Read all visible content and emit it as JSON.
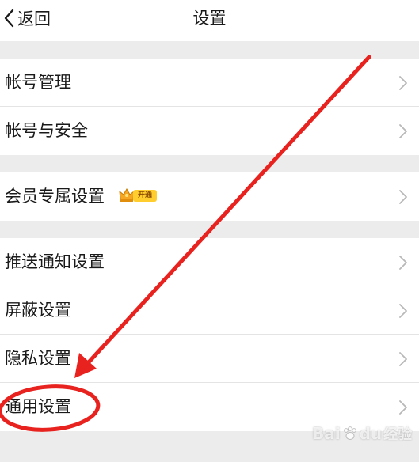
{
  "navbar": {
    "back_label": "返回",
    "title": "设置",
    "back_icon": "chevron-left-icon"
  },
  "sections": [
    {
      "rows": [
        {
          "label": "帐号管理",
          "icon": "chevron-right-icon"
        },
        {
          "label": "帐号与安全",
          "icon": "chevron-right-icon"
        }
      ]
    },
    {
      "rows": [
        {
          "label": "会员专属设置",
          "icon": "chevron-right-icon",
          "badge": {
            "icon": "crown-icon",
            "text": "开通"
          }
        }
      ]
    },
    {
      "rows": [
        {
          "label": "推送通知设置",
          "icon": "chevron-right-icon"
        },
        {
          "label": "屏蔽设置",
          "icon": "chevron-right-icon"
        },
        {
          "label": "隐私设置",
          "icon": "chevron-right-icon"
        },
        {
          "label": "通用设置",
          "icon": "chevron-right-icon"
        }
      ]
    }
  ],
  "annotation": {
    "color": "#e8231f",
    "shapes": [
      "arrow",
      "ellipse"
    ],
    "target": "通用设置"
  },
  "watermark": {
    "brand_left": "Bai",
    "brand_right": "du",
    "suffix": "经验"
  },
  "colors": {
    "background": "#ececec",
    "row_background": "#ffffff",
    "chevron": "#b8b8b8",
    "badge_gold": "#ffcd2e"
  }
}
